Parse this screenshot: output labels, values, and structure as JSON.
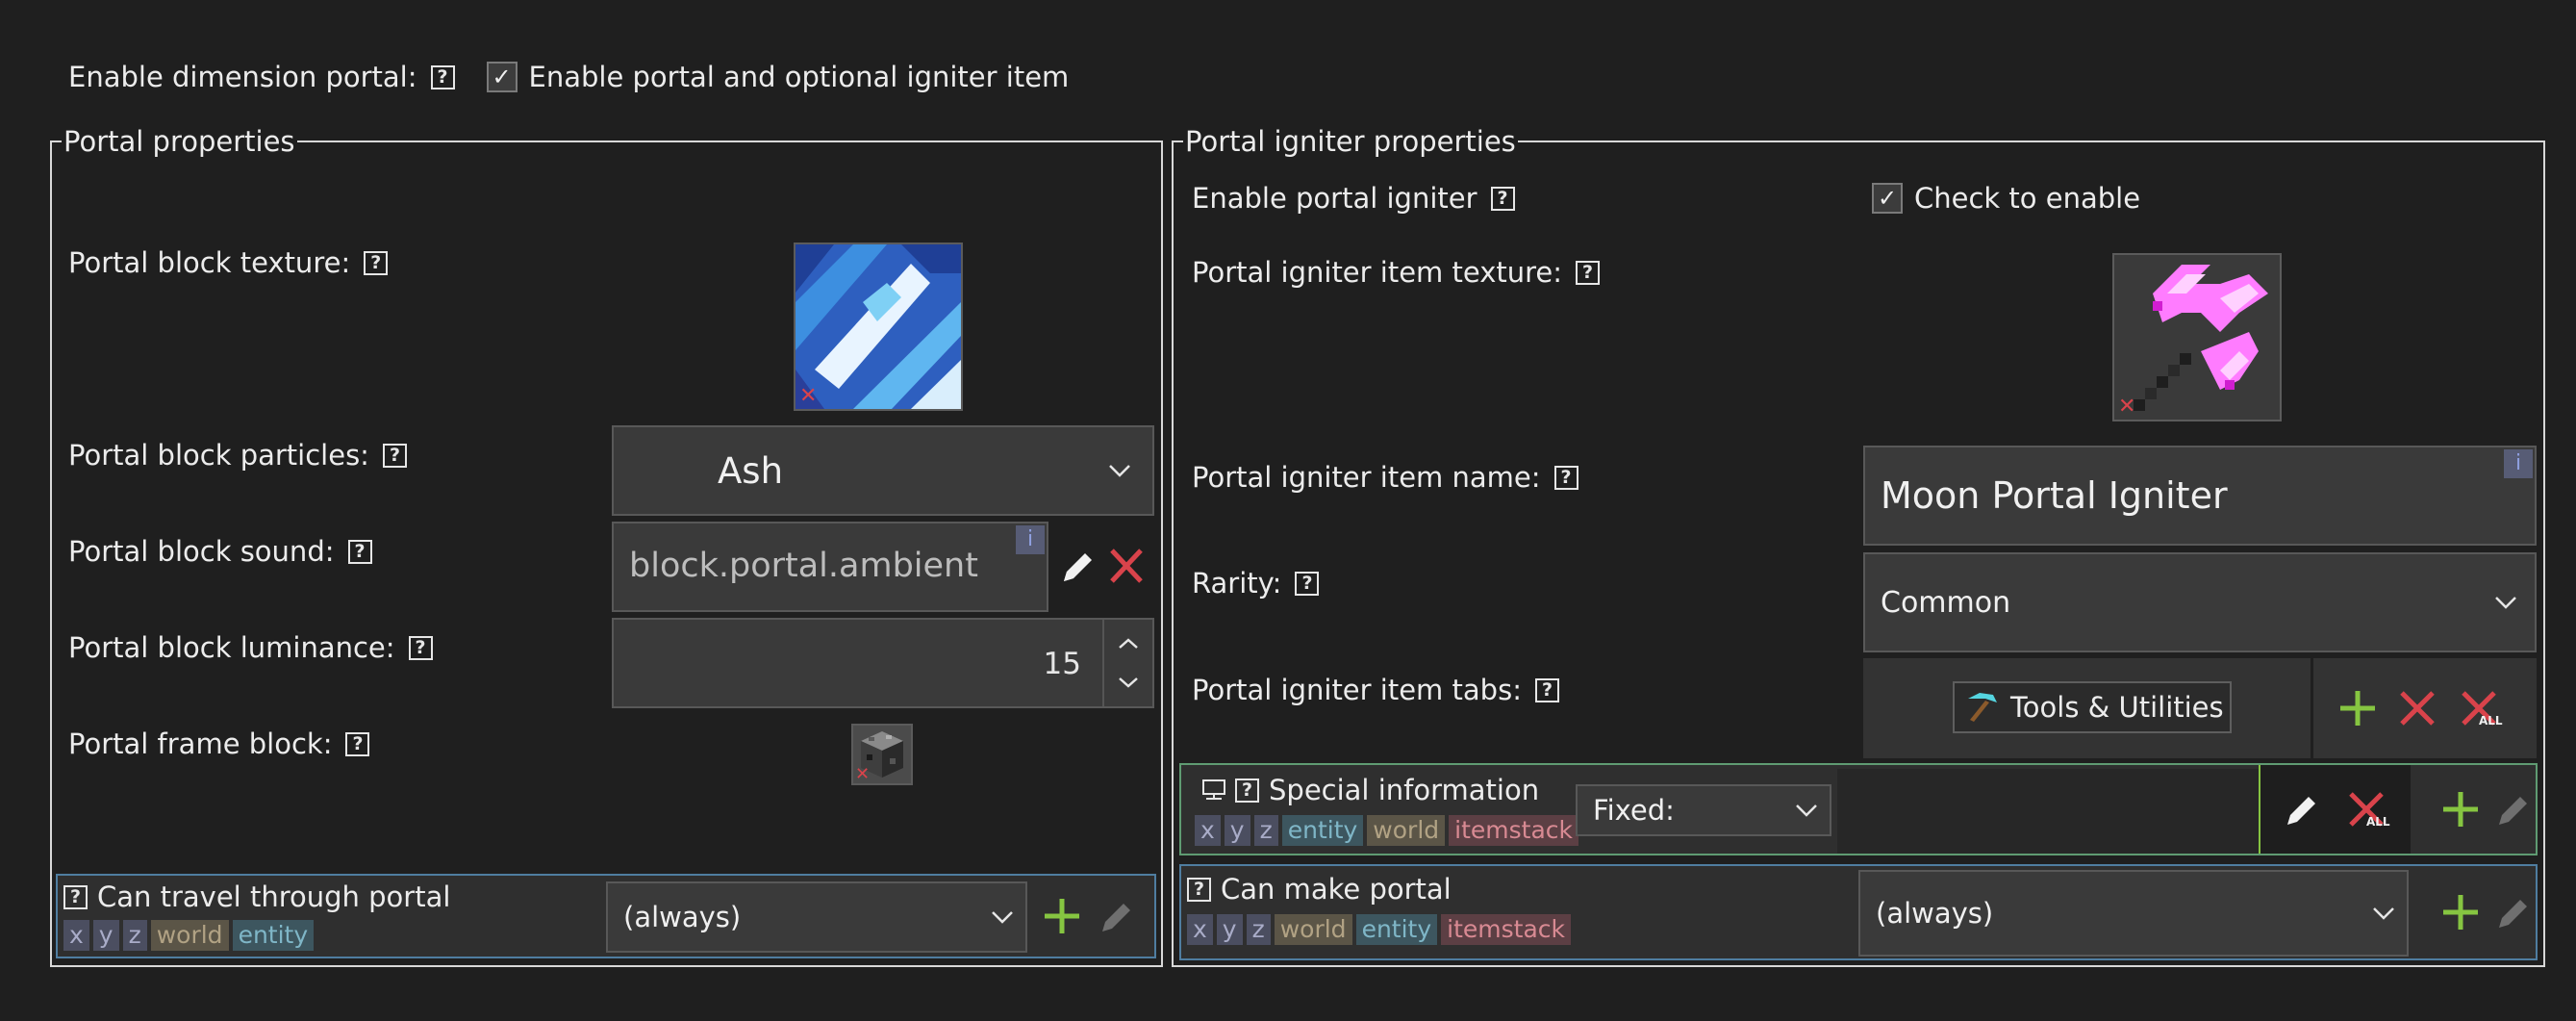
{
  "enable_portal": {
    "label": "Enable dimension portal:",
    "checkbox_label": "Enable portal and optional igniter item",
    "checked": true
  },
  "portal_properties": {
    "legend": "Portal properties",
    "texture_label": "Portal block texture:",
    "particles_label": "Portal block particles:",
    "particles_value": "Ash",
    "sound_label": "Portal block sound:",
    "sound_value": "block.portal.ambient",
    "sound_info": "i",
    "luminance_label": "Portal block luminance:",
    "luminance_value": "15",
    "frame_label": "Portal frame block:",
    "travel": {
      "label": "Can travel through portal",
      "tags": [
        "x",
        "y",
        "z",
        "world",
        "entity"
      ],
      "value": "(always)"
    }
  },
  "igniter_properties": {
    "legend": "Portal igniter properties",
    "enable_label": "Enable portal igniter",
    "enable_checkbox_label": "Check to enable",
    "enable_checked": true,
    "texture_label": "Portal igniter item texture:",
    "name_label": "Portal igniter item name:",
    "name_value": "Moon Portal Igniter",
    "name_info": "i",
    "rarity_label": "Rarity:",
    "rarity_value": "Common",
    "tabs_label": "Portal igniter item tabs:",
    "tabs_value": "Tools & Utilities",
    "special": {
      "label": "Special information",
      "tags": [
        "x",
        "y",
        "z",
        "entity",
        "world",
        "itemstack"
      ],
      "value": "Fixed:"
    },
    "make_portal": {
      "label": "Can make portal",
      "tags": [
        "x",
        "y",
        "z",
        "world",
        "entity",
        "itemstack"
      ],
      "value": "(always)"
    }
  },
  "icons": {
    "help": "?",
    "add": "plus-icon",
    "remove": "cross-icon",
    "remove_all_text": "ALL",
    "edit": "pencil-icon"
  },
  "colors": {
    "background": "#1f1f1f",
    "field": "#3a3a3a",
    "add_green": "#86c541",
    "remove_red": "#d9434b",
    "procedure_border_blue": "#4f7da0",
    "procedure_border_green": "#5f9b72"
  }
}
